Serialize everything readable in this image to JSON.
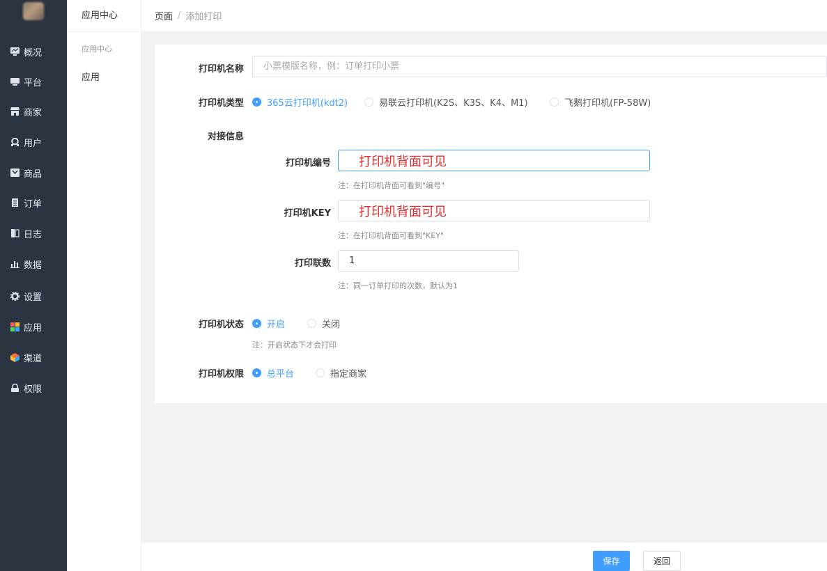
{
  "sidebar": {
    "items": [
      {
        "label": "概况",
        "icon": "monitor-icon"
      },
      {
        "label": "平台",
        "icon": "platform-icon"
      },
      {
        "label": "商家",
        "icon": "store-icon"
      },
      {
        "label": "用户",
        "icon": "user-icon"
      },
      {
        "label": "商品",
        "icon": "goods-icon"
      },
      {
        "label": "订单",
        "icon": "order-icon"
      },
      {
        "label": "日志",
        "icon": "log-icon"
      },
      {
        "label": "数据",
        "icon": "chart-icon"
      },
      {
        "label": "设置",
        "icon": "gear-icon"
      },
      {
        "label": "应用",
        "icon": "apps-icon"
      },
      {
        "label": "渠道",
        "icon": "channel-icon"
      },
      {
        "label": "权限",
        "icon": "lock-icon"
      }
    ]
  },
  "subnav": {
    "header": "应用中心",
    "group": "应用中心",
    "item": "应用"
  },
  "breadcrumb": {
    "root": "页面",
    "separator": "/",
    "current": "添加打印"
  },
  "form": {
    "name_label": "打印机名称",
    "name_placeholder": "小票模版名称，例：订单打印小票",
    "type_label": "打印机类型",
    "type_options": [
      "365云打印机(kdt2)",
      "易联云打印机(K2S、K3S、K4、M1)",
      "飞鹅打印机(FP-58W)"
    ],
    "section_title": "对接信息",
    "serial_label": "打印机编号",
    "serial_value": "打印机背面可见",
    "serial_note": "注：在打印机背面可看到\"编号\"",
    "key_label": "打印机KEY",
    "key_value": "打印机背面可见",
    "key_note": "注：在打印机背面可看到\"KEY\"",
    "copies_label": "打印联数",
    "copies_value": "1",
    "copies_note": "注：同一订单打印的次数，默认为1",
    "status_label": "打印机状态",
    "status_options": [
      "开启",
      "关闭"
    ],
    "status_note": "注：开启状态下才会打印",
    "perm_label": "打印机权限",
    "perm_options": [
      "总平台",
      "指定商家"
    ]
  },
  "footer": {
    "save": "保存",
    "back": "返回"
  },
  "colors": {
    "accent": "#409eff",
    "sidebar_bg": "#2b3541",
    "highlight_text": "#e62c2c"
  }
}
